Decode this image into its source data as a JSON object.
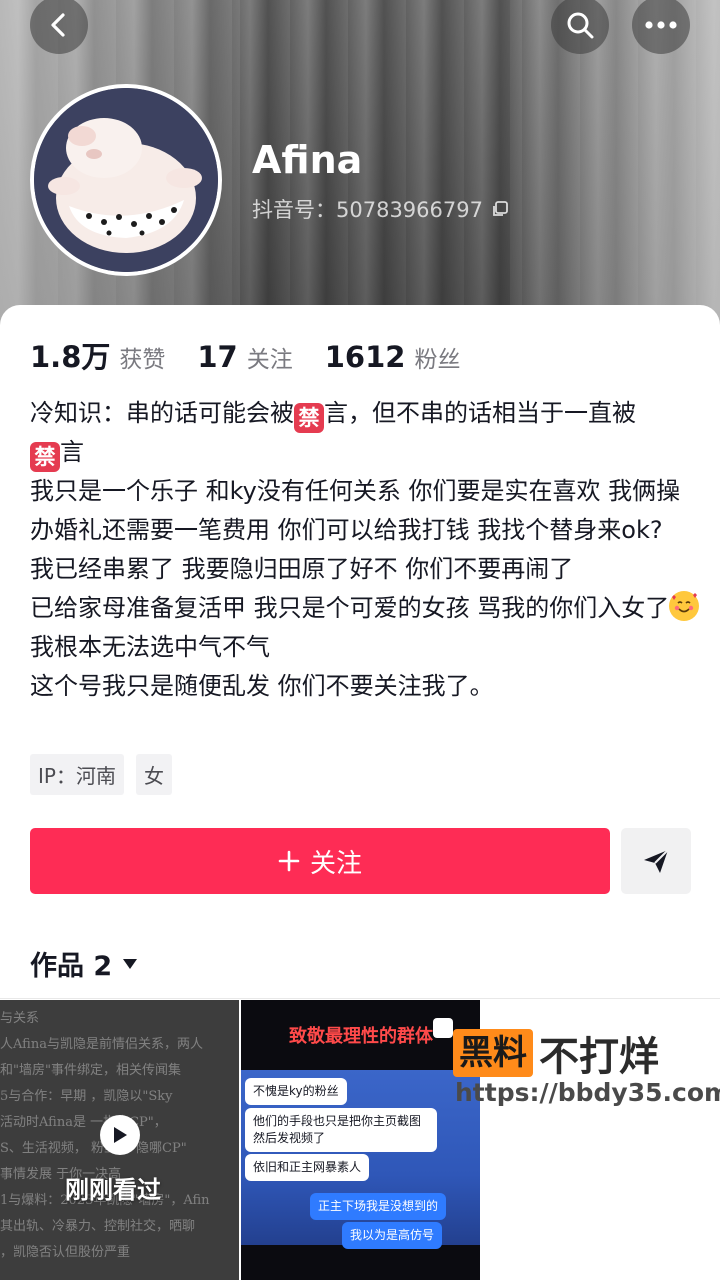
{
  "profile": {
    "name": "Afina",
    "douyin_id": "抖音号：50783966797"
  },
  "stats": [
    {
      "num": "1.8万",
      "label": "获赞"
    },
    {
      "num": "17",
      "label": "关注"
    },
    {
      "num": "1612",
      "label": "粉丝"
    }
  ],
  "bio": {
    "line1a": "冷知识：串的话可能会被",
    "line1b": "言，但不串的话相当于一直被",
    "line1c": "言",
    "ban_char": "禁",
    "line2": "我只是一个乐子 和ky没有任何关系 你们要是实在喜欢 我俩操办婚礼还需要一笔费用 你们可以给我打钱 我找个替身来ok?",
    "line3": "我已经串累了 我要隐归田原了好不 你们不要再闹了",
    "line4a": "已给家母准备复活甲 我只是个可爱的女孩 骂我的你们入女了",
    "line4b": " 我根本无法选中气不气",
    "line5": "这个号我只是随便乱发 你们不要关注我了。"
  },
  "tags": [
    "IP：河南",
    "女"
  ],
  "actions": {
    "follow_label": "关注"
  },
  "works": {
    "label": "作品 2"
  },
  "thumbs": {
    "seen_label": "刚刚看过",
    "doc_lines": [
      "与关系",
      "人Afina与凯隐是前情侣关系，两人",
      "和\"墙房\"事件绑定，相关传闻集",
      "5与合作：早期",
      "，凯隐以\"Sky",
      "活动时Afina是",
      "一指定CP\"，",
      "S、生活视频，",
      "粉丝骑\"隐哪CP\"",
      "事情发展",
      "于你一决高",
      "1与爆料：2023年凯隐\"墙房\"，Afin",
      "其出轨、冷暴力、控制社交，晒聊",
      "，凯隐否认但股份严重"
    ],
    "video2_title": "致敬最理性的群体",
    "chat1": "不愧是ky的粉丝",
    "chat2": "他们的手段也只是把你主页截图然后发视频了",
    "chat3": "依旧和正主网暴素人",
    "chat4": "正主下场我是没想到的",
    "chat5": "我以为是高仿号"
  },
  "watermark": {
    "box": "黑料",
    "text": "不打烊",
    "url": "https://bbdy35.com"
  },
  "colors": {
    "accent": "#fe2c55",
    "ban_emoji": "#e53b50"
  }
}
